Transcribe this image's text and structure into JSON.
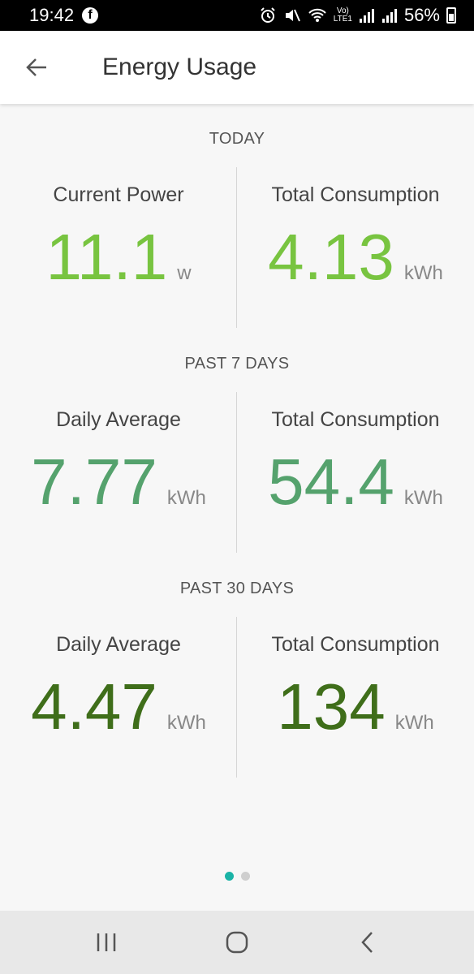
{
  "status_bar": {
    "time": "19:42",
    "battery": "56%",
    "network_label": "LTE1"
  },
  "app_bar": {
    "title": "Energy Usage"
  },
  "sections": [
    {
      "label": "TODAY",
      "left": {
        "title": "Current Power",
        "value": "11.1",
        "unit": "w",
        "color": "#78c440"
      },
      "right": {
        "title": "Total Consumption",
        "value": "4.13",
        "unit": "kWh",
        "color": "#78c440"
      }
    },
    {
      "label": "PAST 7 DAYS",
      "left": {
        "title": "Daily Average",
        "value": "7.77",
        "unit": "kWh",
        "color": "#55a26d"
      },
      "right": {
        "title": "Total Consumption",
        "value": "54.4",
        "unit": "kWh",
        "color": "#55a26d"
      }
    },
    {
      "label": "PAST 30 DAYS",
      "left": {
        "title": "Daily Average",
        "value": "4.47",
        "unit": "kWh",
        "color": "#3f6e1a"
      },
      "right": {
        "title": "Total Consumption",
        "value": "134",
        "unit": "kWh",
        "color": "#3f6e1a"
      }
    }
  ],
  "pager": {
    "pages": 2,
    "active": 1,
    "active_color": "#1ab3a6"
  }
}
